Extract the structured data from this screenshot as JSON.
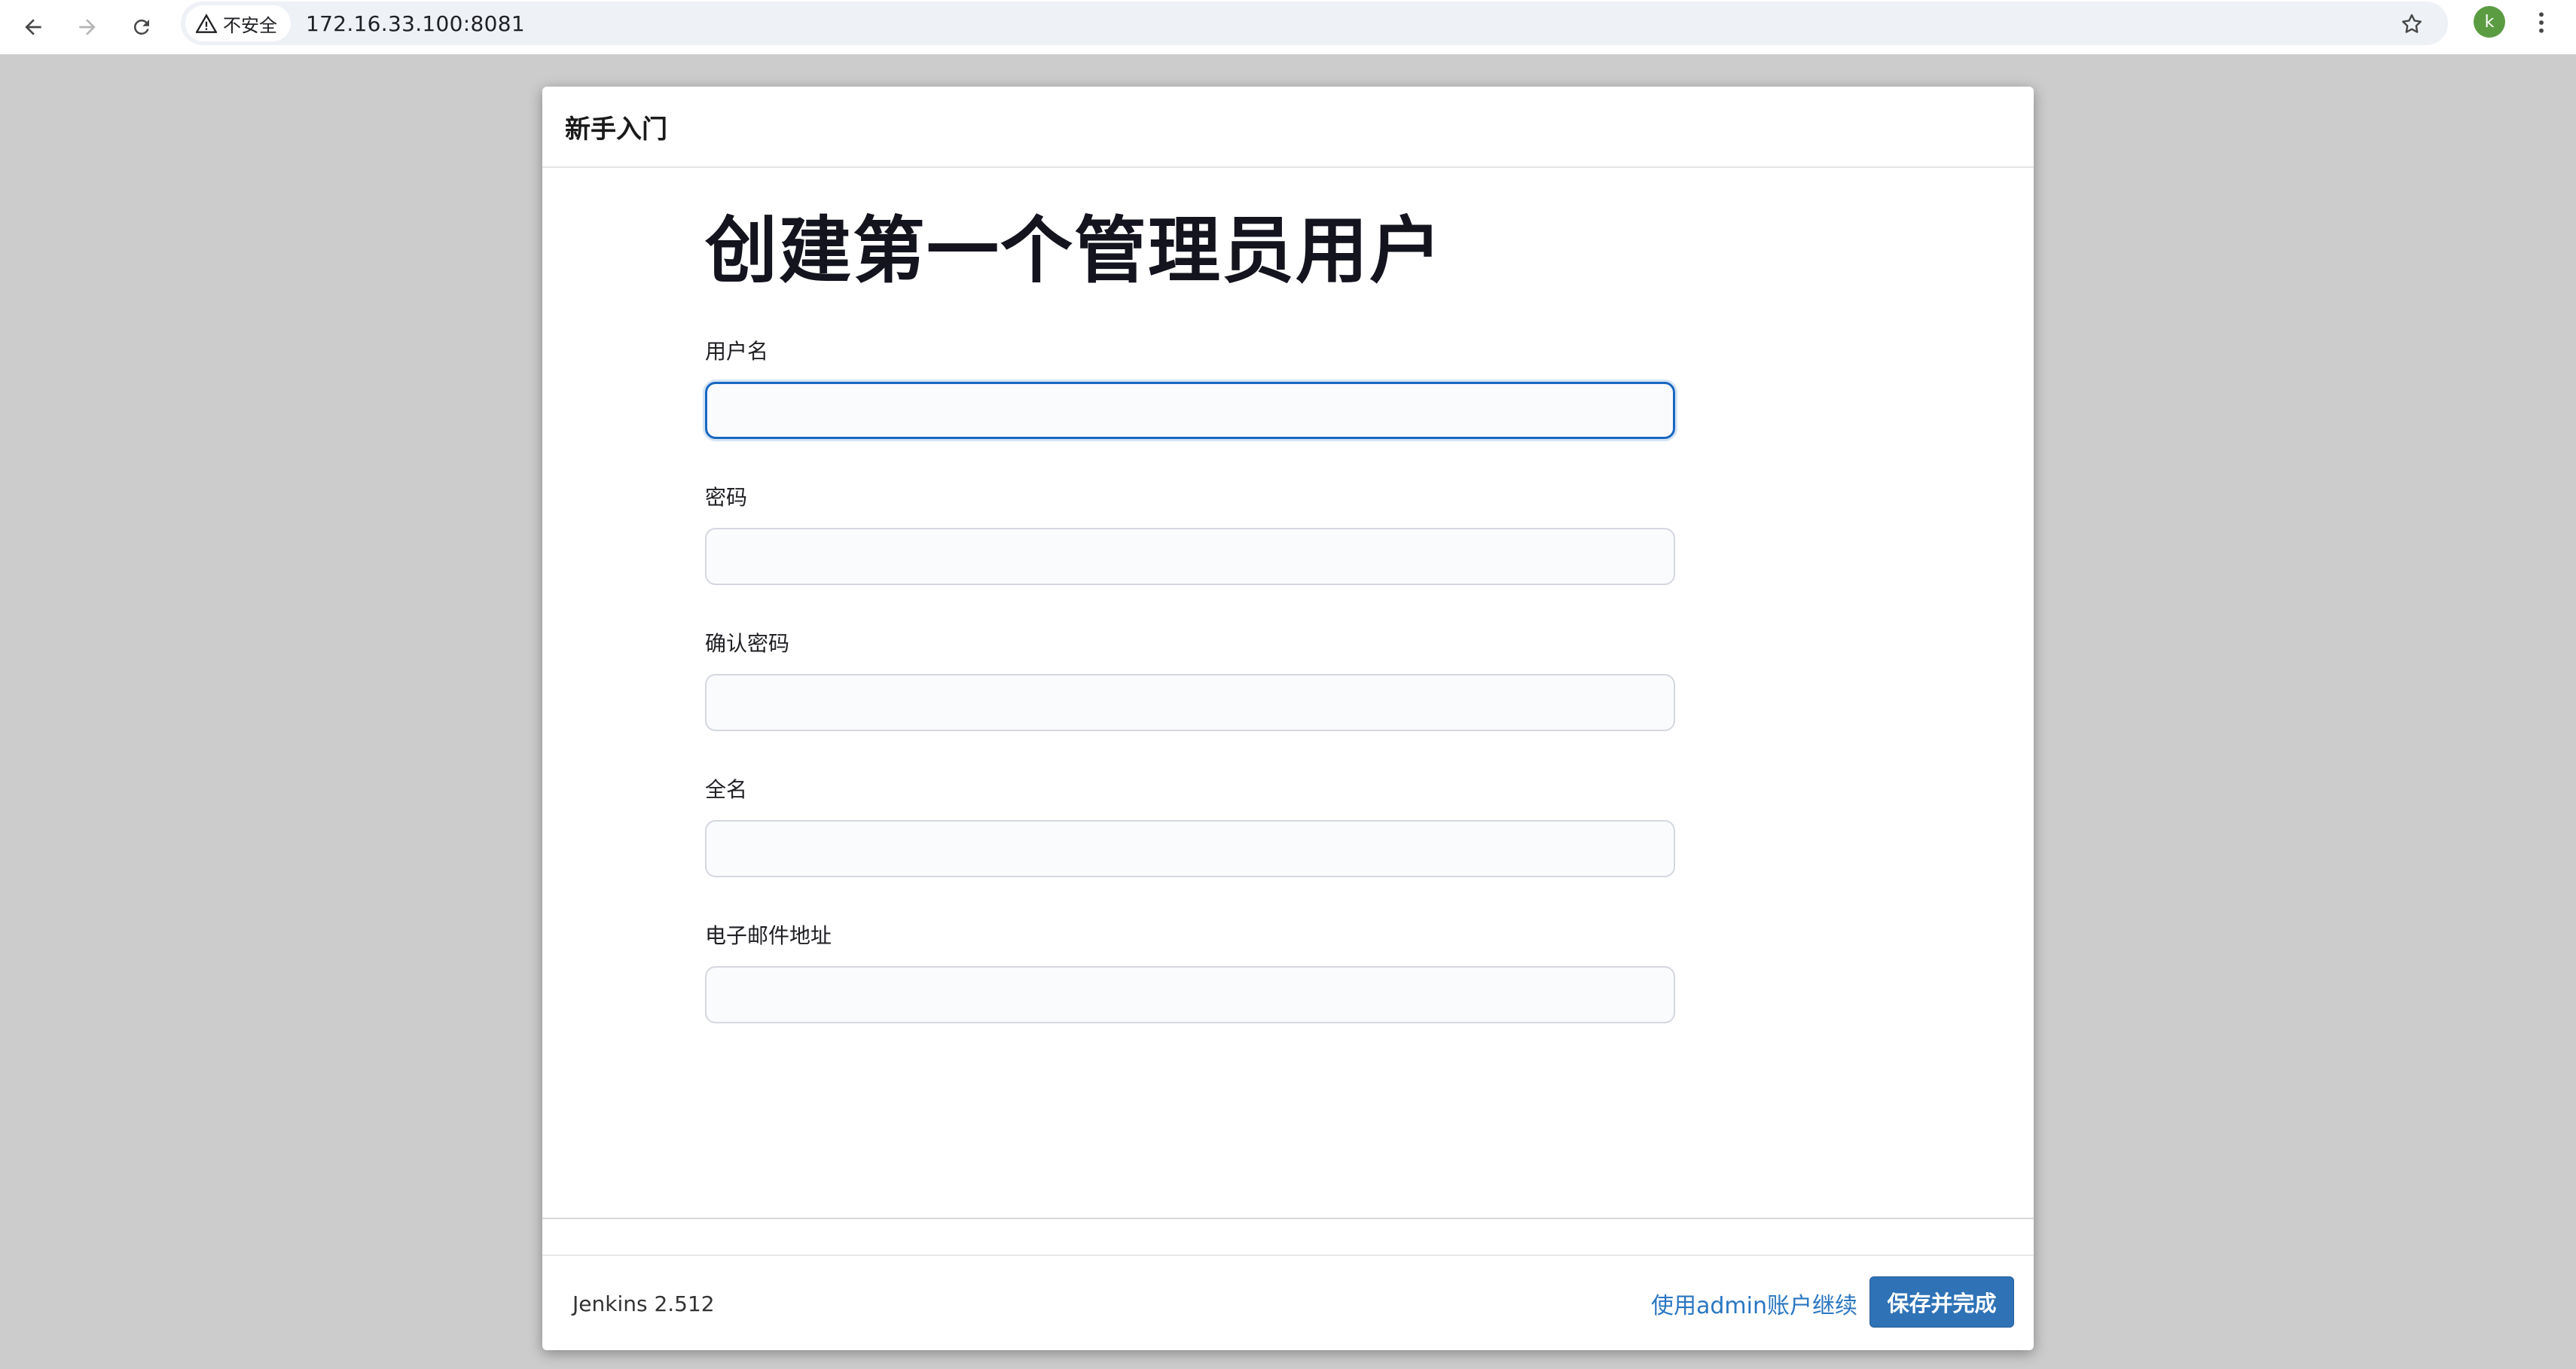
{
  "browser": {
    "security_label": "不安全",
    "url": "172.16.33.100:8081",
    "profile_initial": "k"
  },
  "dialog": {
    "title": "新手入门",
    "heading": "创建第一个管理员用户",
    "fields": [
      {
        "label": "用户名",
        "value": ""
      },
      {
        "label": "密码",
        "value": ""
      },
      {
        "label": "确认密码",
        "value": ""
      },
      {
        "label": "全名",
        "value": ""
      },
      {
        "label": "电子邮件地址",
        "value": ""
      }
    ],
    "footer": {
      "version": "Jenkins 2.512",
      "continue_link": "使用admin账户继续",
      "save_button": "保存并完成"
    }
  },
  "colors": {
    "accent": "#2f73b6",
    "link": "#2a76c2",
    "focus": "#1868c0",
    "avatar": "#5b9c43"
  }
}
